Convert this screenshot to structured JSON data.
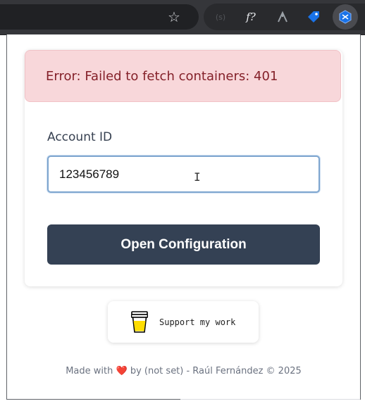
{
  "browser": {
    "bookmark_icon": "star-icon",
    "extensions": [
      {
        "name": "faded-extension",
        "glyph": "(s)"
      },
      {
        "name": "formula-extension",
        "glyph": "f?"
      },
      {
        "name": "branch-extension",
        "glyph": "⑂"
      },
      {
        "name": "tag-extension",
        "glyph": "◆"
      },
      {
        "name": "container-extension",
        "glyph": "⬡"
      }
    ]
  },
  "popup": {
    "error_message": "Error: Failed to fetch containers: 401",
    "account_label": "Account ID",
    "account_value": "123456789",
    "open_button_label": "Open Configuration",
    "support_label": "Support my work",
    "footer": {
      "prefix": "Made with",
      "heart": "❤️",
      "suffix": "by (not set) - Raúl Fernández © 2025"
    }
  },
  "colors": {
    "error_bg": "#f8d7da",
    "error_text": "#842029",
    "button_bg": "#344154",
    "input_border": "#7fa6cf"
  }
}
